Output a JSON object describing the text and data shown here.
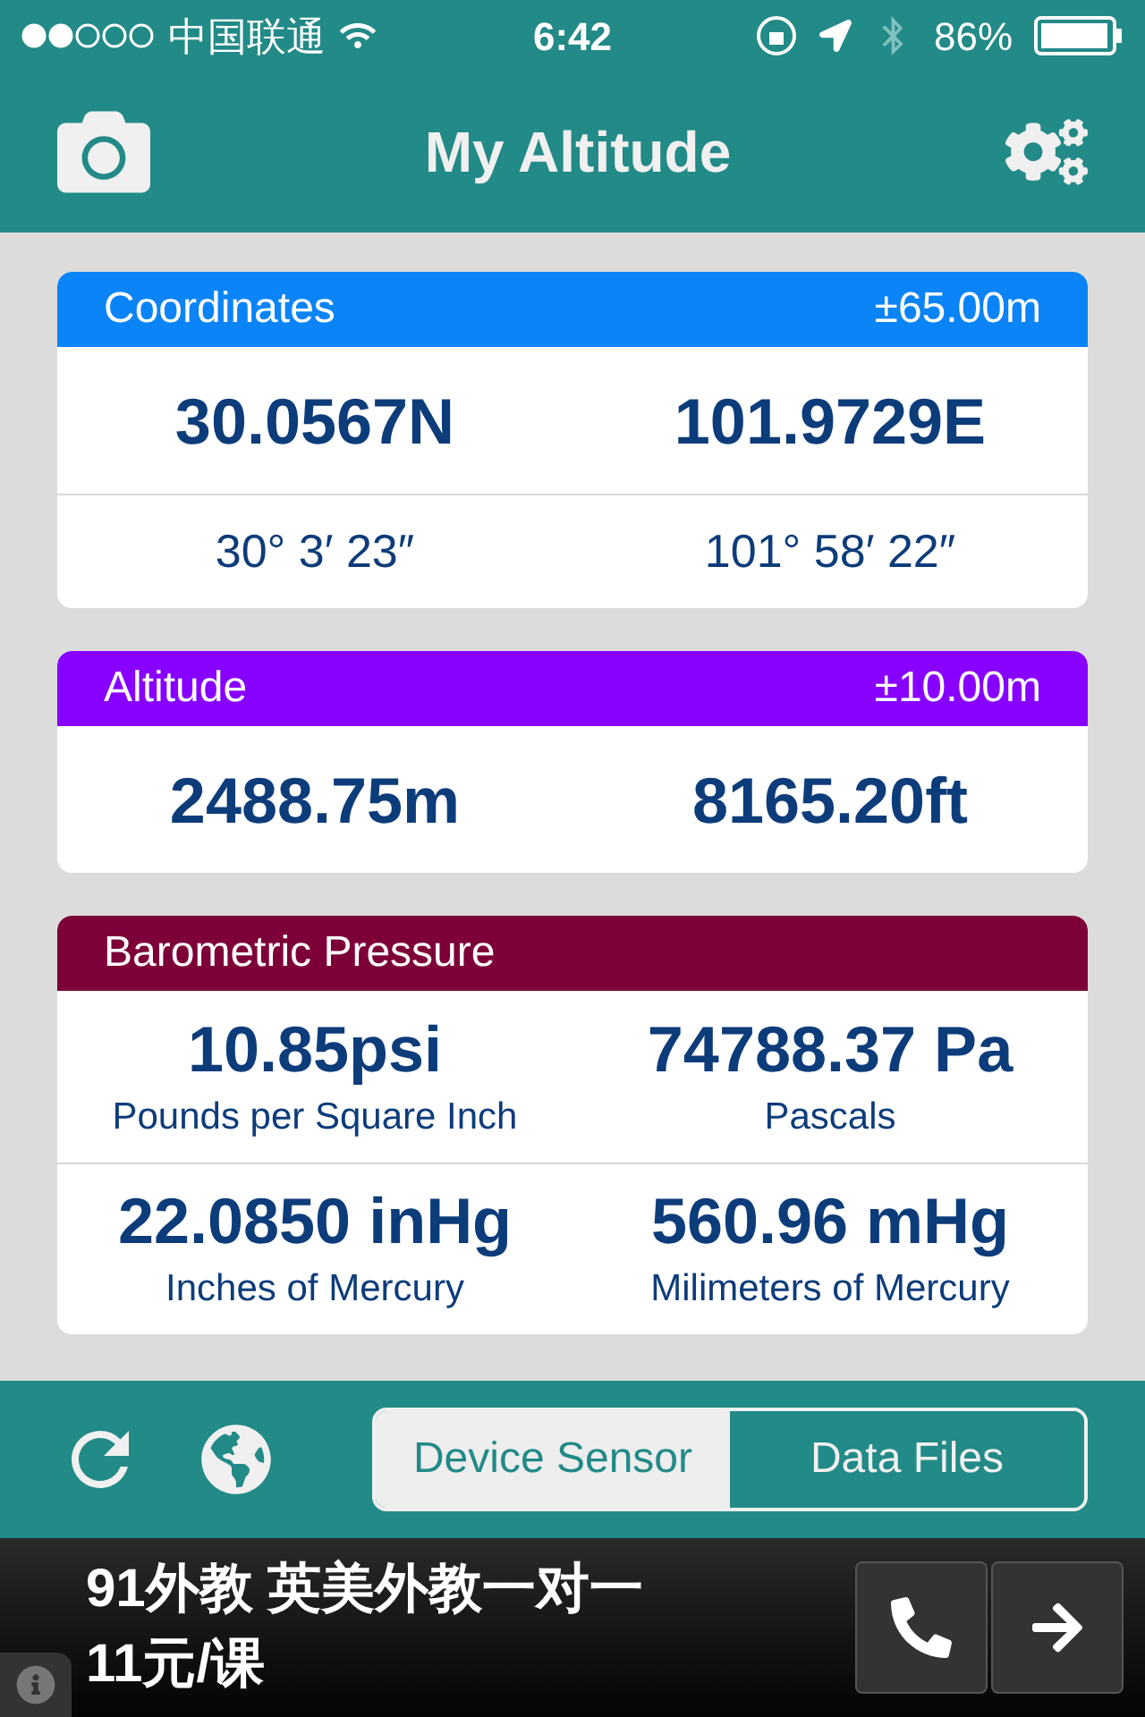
{
  "status_bar": {
    "carrier": "中国联通",
    "time": "6:42",
    "battery": "86%"
  },
  "nav": {
    "title": "My Altitude"
  },
  "cards": [
    {
      "title": "Coordinates",
      "accuracy": "±65.00m",
      "color": "#0a84f7",
      "rows": [
        [
          {
            "value": "30.0567N"
          },
          {
            "value": "101.9729E"
          }
        ],
        [
          {
            "value": "30° 3′ 23″",
            "kind": "small"
          },
          {
            "value": "101° 58′ 22″",
            "kind": "small"
          }
        ]
      ]
    },
    {
      "title": "Altitude",
      "accuracy": "±10.00m",
      "color": "#8800ff",
      "rows": [
        [
          {
            "value": "2488.75m"
          },
          {
            "value": "8165.20ft"
          }
        ]
      ]
    },
    {
      "title": "Barometric Pressure",
      "color": "#7d0038",
      "rows": [
        [
          {
            "value": "10.85psi",
            "caption": "Pounds per Square Inch"
          },
          {
            "value": "74788.37 Pa",
            "caption": "Pascals"
          }
        ],
        [
          {
            "value": "22.0850 inHg",
            "caption": "Inches of Mercury"
          },
          {
            "value": "560.96 mHg",
            "caption": "Milimeters of Mercury"
          }
        ]
      ]
    }
  ],
  "segments": [
    {
      "label": "Device Sensor",
      "selected": true
    },
    {
      "label": "Data Files",
      "selected": false
    }
  ],
  "ad": {
    "lines": [
      "91外教 英美外教一对一",
      "11元/课"
    ]
  }
}
